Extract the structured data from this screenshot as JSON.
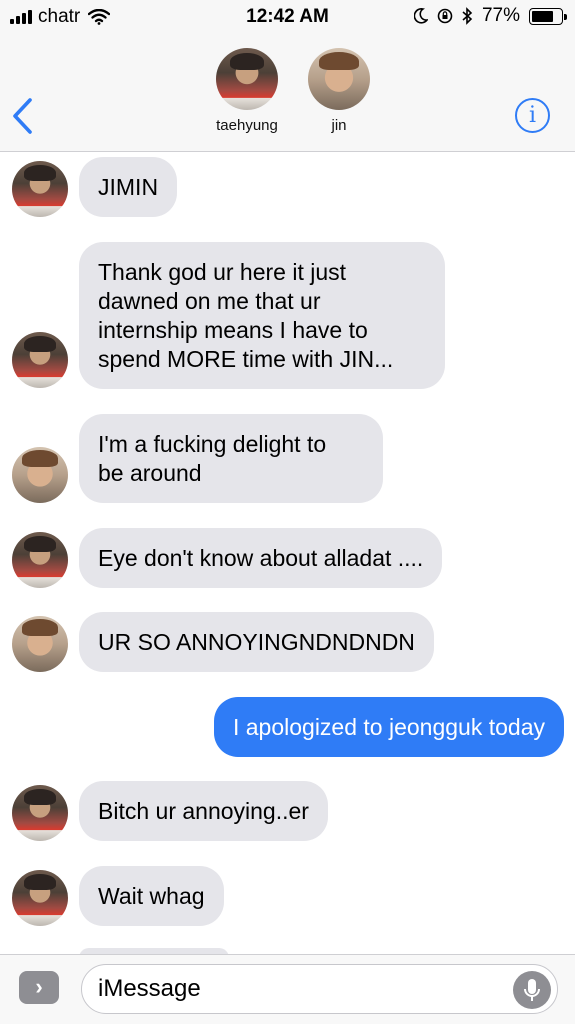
{
  "status_bar": {
    "carrier": "chatr",
    "time": "12:42 AM",
    "battery": "77%",
    "battery_level": 0.77
  },
  "header": {
    "back_icon": "chevron-left-icon",
    "info_icon": "info-icon",
    "contacts": [
      {
        "name": "taehyung"
      },
      {
        "name": "jin"
      }
    ]
  },
  "messages": [
    {
      "sender": "taehyung",
      "direction": "in",
      "text": "JIMIN"
    },
    {
      "sender": "taehyung",
      "direction": "in",
      "text": "Thank god ur here it just\ndawned on me that ur\ninternship means I have to\nspend  MORE time with JIN..."
    },
    {
      "sender": "jin",
      "direction": "in",
      "text": "I'm a fucking delight to\nbe around"
    },
    {
      "sender": "taehyung",
      "direction": "in",
      "text": "Eye don't know about alladat ...."
    },
    {
      "sender": "jin",
      "direction": "in",
      "text": "UR SO ANNOYINGNDNDNDN"
    },
    {
      "sender": "me",
      "direction": "out",
      "text": "I apologized to jeongguk today"
    },
    {
      "sender": "taehyung",
      "direction": "in",
      "text": "Bitch ur annoying..er"
    },
    {
      "sender": "taehyung",
      "direction": "in",
      "text": "Wait whag"
    }
  ],
  "input_bar": {
    "placeholder": "iMessage",
    "expand_icon": "chevron-right-icon",
    "mic_icon": "microphone-icon"
  },
  "colors": {
    "incoming_bubble": "#e5e5ea",
    "outgoing_bubble": "#2f7cf6",
    "accent": "#2f7cf6"
  }
}
